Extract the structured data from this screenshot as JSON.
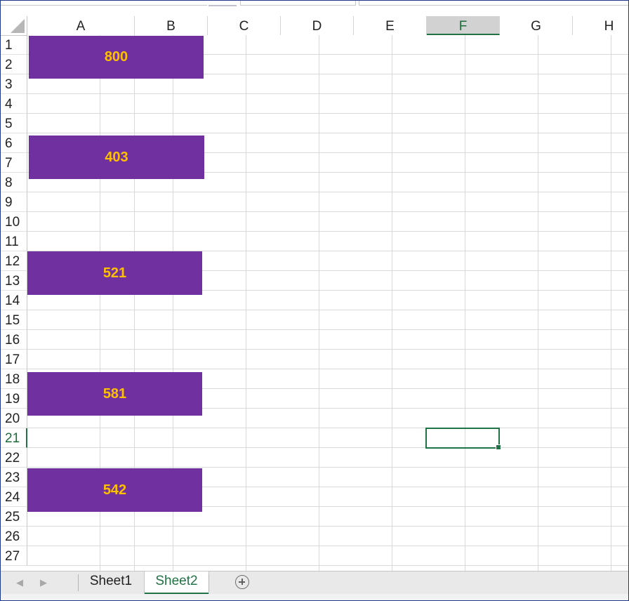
{
  "columns": [
    {
      "label": "A"
    },
    {
      "label": "B"
    },
    {
      "label": "C"
    },
    {
      "label": "D"
    },
    {
      "label": "E"
    },
    {
      "label": "F",
      "selected": true
    },
    {
      "label": "G"
    },
    {
      "label": "H"
    }
  ],
  "rows": [
    "1",
    "2",
    "3",
    "4",
    "5",
    "6",
    "7",
    "8",
    "9",
    "10",
    "11",
    "12",
    "13",
    "14",
    "15",
    "16",
    "17",
    "18",
    "19",
    "20",
    "21",
    "22",
    "23",
    "24",
    "25",
    "26",
    "27"
  ],
  "selected_row": "21",
  "active_cell": "F21",
  "shapes": [
    {
      "value": "800",
      "rows": "1-2"
    },
    {
      "value": "403",
      "rows": "6-7"
    },
    {
      "value": "521",
      "rows": "12-13"
    },
    {
      "value": "581",
      "rows": "18-19"
    },
    {
      "value": "542",
      "rows": "23-24"
    }
  ],
  "shape_colors": {
    "fill": "#7030a0",
    "text": "#ffc000"
  },
  "sheet_tabs": [
    {
      "label": "Sheet1",
      "active": false
    },
    {
      "label": "Sheet2",
      "active": true
    }
  ],
  "accent_color": "#217346",
  "icons": {
    "select_all": "select-all-triangle",
    "prev_sheet": "chevron-left-icon",
    "next_sheet": "chevron-right-icon",
    "add_sheet": "plus-circle-icon"
  }
}
